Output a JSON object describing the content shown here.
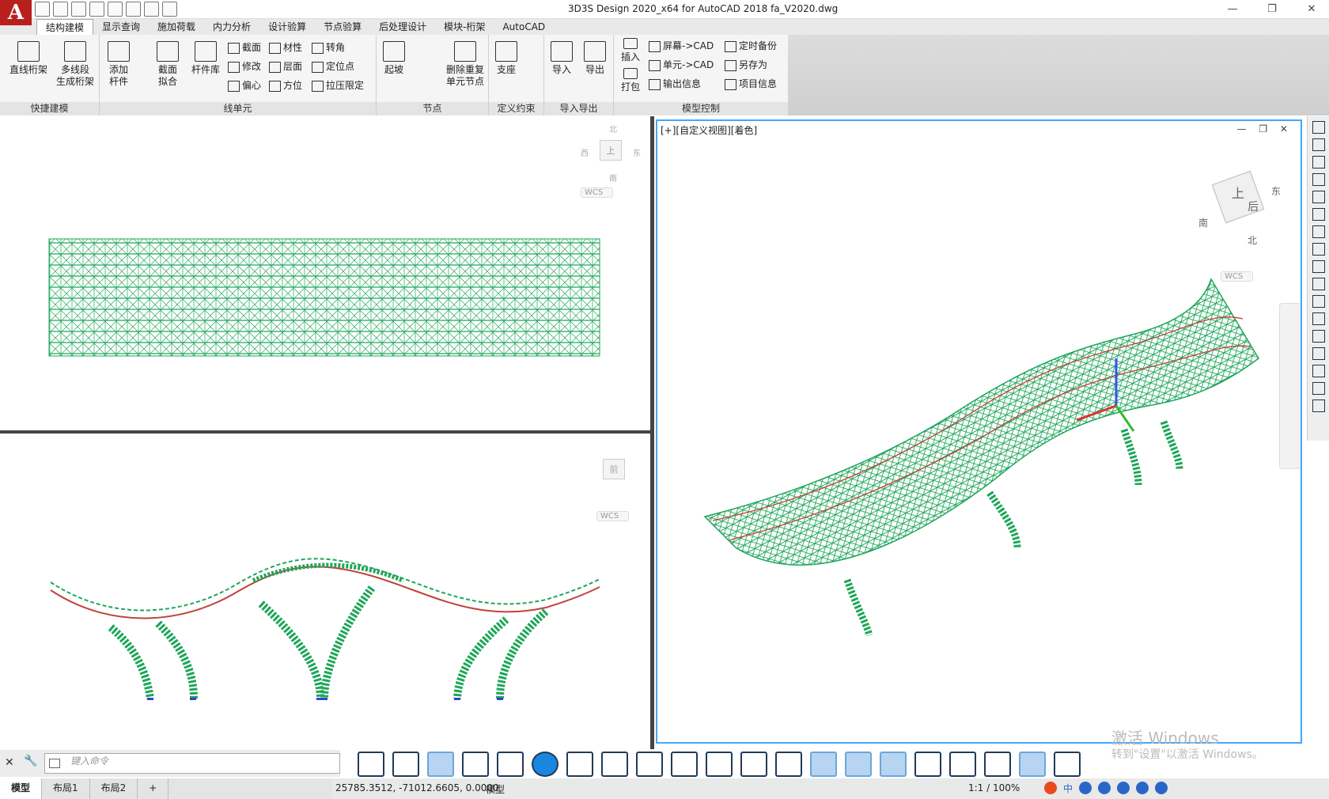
{
  "window": {
    "title": "3D3S Design 2020_x64 for AutoCAD 2018    fa_V2020.dwg",
    "controls": [
      "—",
      "❐",
      "✕"
    ]
  },
  "app_button": {
    "letter": "A"
  },
  "tabs": [
    "结构建模",
    "显示查询",
    "施加荷载",
    "内力分析",
    "设计验算",
    "节点验算",
    "后处理设计",
    "模块-桁架",
    "AutoCAD"
  ],
  "ribbon": {
    "kuaijie": {
      "label": "快捷建模",
      "buttons": [
        "直线桁架",
        "多线段\n生成桁架"
      ]
    },
    "xian": {
      "label": "线单元",
      "big": [
        "添加\n杆件",
        "截面\n拟合",
        "杆件库"
      ],
      "small": [
        "截面",
        "修改",
        "偏心",
        "材性",
        "层面",
        "方位",
        "转角",
        "定位点",
        "拉压限定"
      ]
    },
    "jiedian": {
      "label": "节点",
      "big": [
        "起坡",
        "删除重复\n单元节点"
      ]
    },
    "yueshu": {
      "label": "定义约束",
      "big": [
        "支座"
      ]
    },
    "daoru": {
      "label": "导入导出",
      "big": [
        "导入",
        "导出"
      ]
    },
    "model": {
      "label": "模型控制",
      "big": [
        "插入",
        "打包"
      ],
      "small": [
        "屏幕->CAD",
        "单元->CAD",
        "输出信息",
        "定时备份",
        "另存为",
        "项目信息"
      ]
    }
  },
  "viewports": {
    "top": {
      "cube": {
        "n": "北",
        "w": "西",
        "e": "东",
        "s": "南",
        "face": "上"
      },
      "wcs": "WCS"
    },
    "front": {
      "cube_face": "前",
      "wcs": "WCS"
    },
    "iso": {
      "label": "[+][自定义视图][着色]",
      "cube": {
        "top": "上",
        "left": "后",
        "east": "东",
        "south": "南",
        "north": "北"
      },
      "wcs": "WCS"
    }
  },
  "watermark": {
    "line1": "激活 Windows",
    "line2": "转到\"设置\"以激活 Windows。"
  },
  "command": {
    "placeholder": "键入命令"
  },
  "layouts": [
    "模型",
    "布局1",
    "布局2",
    "+"
  ],
  "status": {
    "coords": "25785.3512, -71012.6605, 0.0000",
    "mode": "模型",
    "scale": "1:1 / 100%"
  },
  "ime": {
    "lang": "中"
  },
  "colors": {
    "truss": "#1fa65a",
    "chord": "#c0433a",
    "accent": "#44a6ff"
  }
}
